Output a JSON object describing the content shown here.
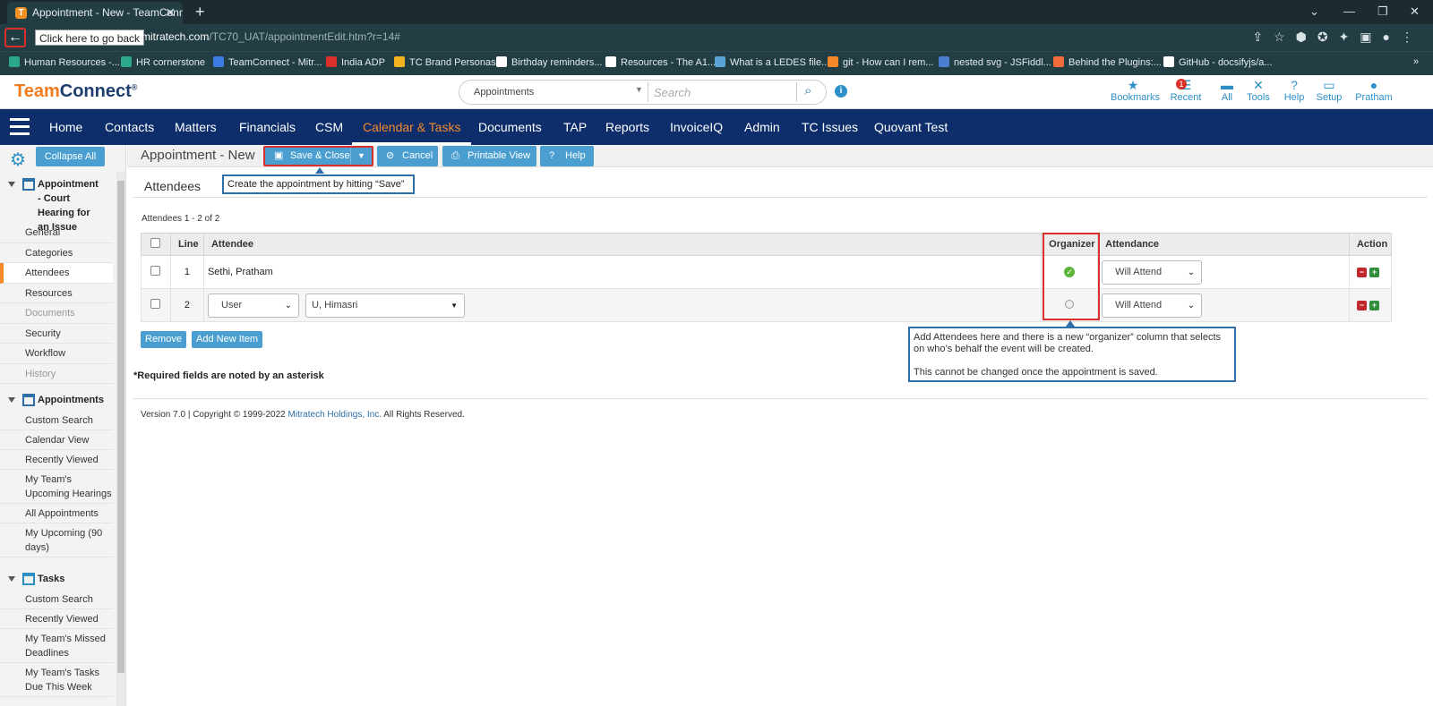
{
  "browser": {
    "tab_title": "Appointment - New - TeamConn",
    "tab_favicon_letter": "T",
    "new_tab": "+",
    "back_tooltip": "Click here to go back",
    "url_host": "mitratech.com",
    "url_path": "/TC70_UAT/appointmentEdit.htm?r=14#",
    "bookmarks": [
      {
        "label": "Human Resources -...",
        "icon": "#2aa889"
      },
      {
        "label": "HR cornerstone",
        "icon": "#2aa889"
      },
      {
        "label": "TeamConnect - Mitr...",
        "icon": "#3c7be0"
      },
      {
        "label": "India ADP",
        "icon": "#d9302c"
      },
      {
        "label": "TC Brand Personas",
        "icon": "#f2b31e"
      },
      {
        "label": "Birthday reminders...",
        "icon": "#ffffff"
      },
      {
        "label": "Resources - The A1...",
        "icon": "#ffffff"
      },
      {
        "label": "What is a LEDES file...",
        "icon": "#5aa3d6"
      },
      {
        "label": "git - How can I rem...",
        "icon": "#f5892a"
      },
      {
        "label": "nested svg - JSFiddl...",
        "icon": "#4a7fd0"
      },
      {
        "label": "Behind the Plugins:...",
        "icon": "#f26b3a"
      },
      {
        "label": "GitHub - docsifyjs/a...",
        "icon": "#ffffff"
      }
    ]
  },
  "header": {
    "logo_team": "Team",
    "logo_connect": "Connect",
    "logo_mark": "®",
    "search_scope": "Appointments",
    "search_placeholder": "Search",
    "utility": [
      {
        "label": "Bookmarks",
        "icon": "star-icon",
        "glyph": "★"
      },
      {
        "label": "Recent",
        "icon": "list-icon",
        "glyph": "☰",
        "badge": "1"
      },
      {
        "label": "All",
        "icon": "folder-icon",
        "glyph": "▬"
      },
      {
        "label": "Tools",
        "icon": "tools-icon",
        "glyph": "✕"
      },
      {
        "label": "Help",
        "icon": "help-icon",
        "glyph": "?"
      },
      {
        "label": "Setup",
        "icon": "monitor-icon",
        "glyph": "▭"
      },
      {
        "label": "Pratham",
        "icon": "user-icon",
        "glyph": "●"
      }
    ]
  },
  "nav": {
    "items": [
      "Home",
      "Contacts",
      "Matters",
      "Financials",
      "CSM",
      "Calendar & Tasks",
      "Documents",
      "TAP",
      "Reports",
      "InvoiceIQ",
      "Admin",
      "TC Issues",
      "Quovant Test"
    ],
    "active": "Calendar & Tasks"
  },
  "sidebar": {
    "collapse_label": "Collapse All",
    "record_title": "Appointment - Court Hearing for an Issue",
    "record_items": [
      "General",
      "Categories",
      "Attendees",
      "Resources",
      "Documents",
      "Security",
      "Workflow",
      "History"
    ],
    "record_active": "Attendees",
    "record_disabled": [
      "Documents",
      "History"
    ],
    "appointments_title": "Appointments",
    "appointments_items": [
      "Custom Search",
      "Calendar View",
      "Recently Viewed",
      "My Team's Upcoming Hearings",
      "All Appointments",
      "My Upcoming (90 days)"
    ],
    "tasks_title": "Tasks",
    "tasks_items": [
      "Custom Search",
      "Recently Viewed",
      "My Team's Missed Deadlines",
      "My Team's Tasks Due This Week"
    ]
  },
  "toolbar": {
    "page_title": "Appointment - New",
    "save_close": "Save & Close",
    "cancel": "Cancel",
    "printable_view": "Printable View",
    "help": "Help"
  },
  "attendees": {
    "section_title": "Attendees",
    "save_callout": "Create the appointment by hitting “Save”",
    "count_text": "Attendees 1 - 2 of 2",
    "columns": [
      "Line",
      "Attendee",
      "Organizer",
      "Attendance",
      "Action"
    ],
    "rows": [
      {
        "line": "1",
        "attendee": "Sethi, Pratham",
        "organizer": true,
        "attendance": "Will Attend"
      },
      {
        "line": "2",
        "attendee_type": "User",
        "attendee": "U, Himasri",
        "organizer": false,
        "attendance": "Will Attend"
      }
    ],
    "remove_label": "Remove",
    "add_label": "Add New Item",
    "organizer_callout_1": "Add Attendees here and there is a new “organizer” column that selects on who’s behalf the event will be created.",
    "organizer_callout_2": "This cannot be changed once the appointment is saved.",
    "required_note": "*Required fields are noted by an asterisk"
  },
  "footer": {
    "prefix": "Version 7.0 | Copyright © 1999-2022",
    "link": "Mitratech Holdings, Inc.",
    "suffix": "All Rights Reserved."
  }
}
